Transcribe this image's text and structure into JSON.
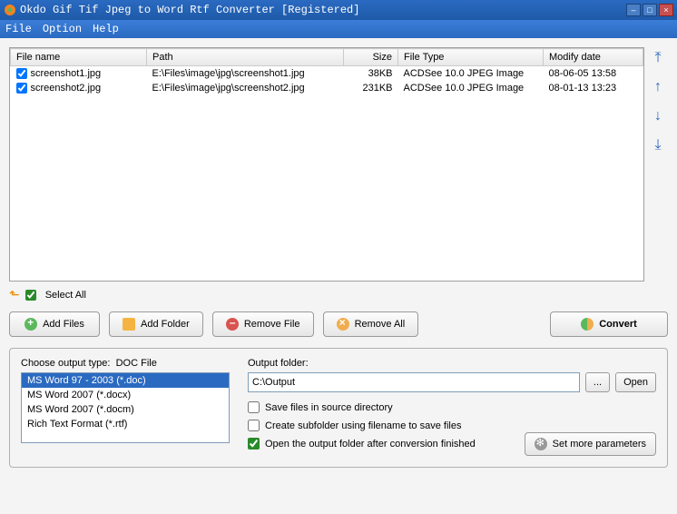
{
  "window": {
    "title": "Okdo Gif Tif Jpeg to Word Rtf Converter [Registered]"
  },
  "menu": {
    "file": "File",
    "option": "Option",
    "help": "Help"
  },
  "columns": {
    "filename": "File name",
    "path": "Path",
    "size": "Size",
    "filetype": "File Type",
    "modify": "Modify date"
  },
  "rows": [
    {
      "name": "screenshot1.jpg",
      "path": "E:\\Files\\image\\jpg\\screenshot1.jpg",
      "size": "38KB",
      "type": "ACDSee 10.0 JPEG Image",
      "modify": "08-06-05 13:58"
    },
    {
      "name": "screenshot2.jpg",
      "path": "E:\\Files\\image\\jpg\\screenshot2.jpg",
      "size": "231KB",
      "type": "ACDSee 10.0 JPEG Image",
      "modify": "08-01-13 13:23"
    }
  ],
  "selectall": "Select All",
  "buttons": {
    "addfiles": "Add Files",
    "addfolder": "Add Folder",
    "removefile": "Remove File",
    "removeall": "Remove All",
    "convert": "Convert"
  },
  "output_type": {
    "label": "Choose output type:",
    "current": "DOC File",
    "options": [
      "MS Word 97 - 2003 (*.doc)",
      "MS Word 2007 (*.docx)",
      "MS Word 2007 (*.docm)",
      "Rich Text Format (*.rtf)"
    ],
    "selected_index": 0
  },
  "output": {
    "label": "Output folder:",
    "path": "C:\\Output",
    "browse": "...",
    "open": "Open"
  },
  "checks": {
    "save_source": "Save files in source directory",
    "create_sub": "Create subfolder using filename to save files",
    "open_after": "Open the output folder after conversion finished"
  },
  "params_btn": "Set more parameters"
}
